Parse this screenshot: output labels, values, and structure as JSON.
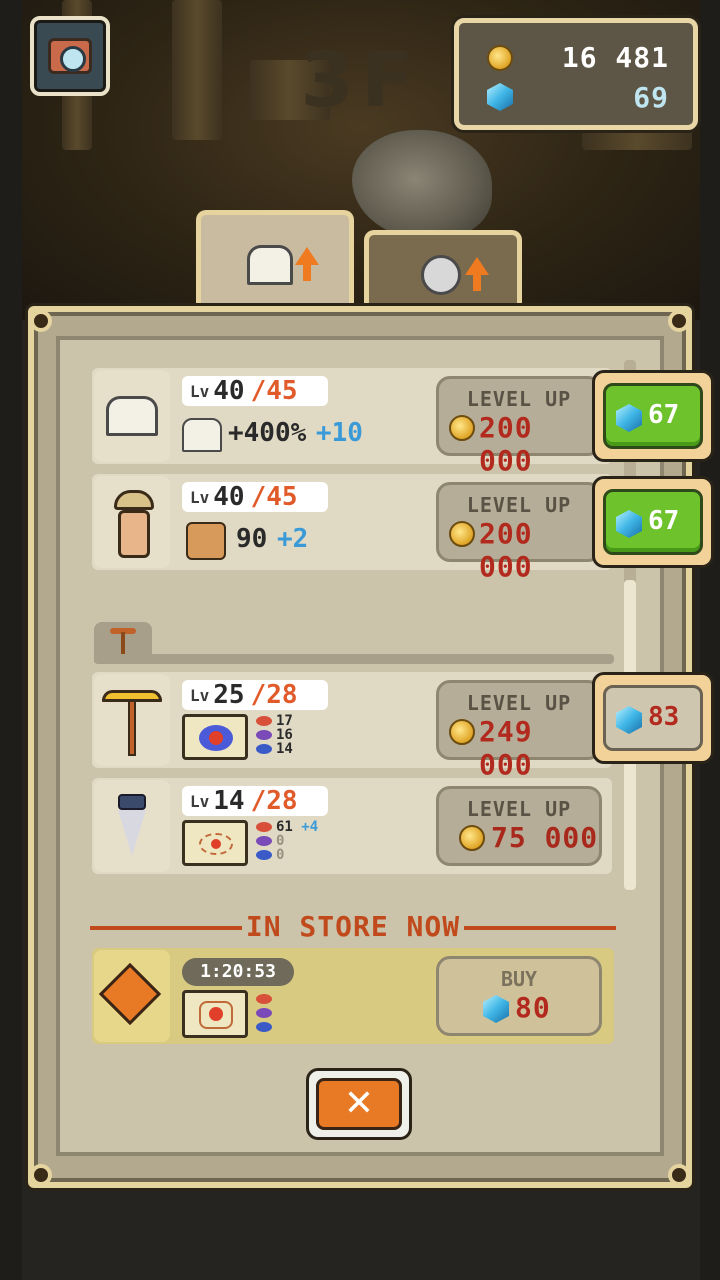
{
  "scene": {
    "floor_label": "3F"
  },
  "currency": {
    "gold": "16 481",
    "gems": "69"
  },
  "tabs": [
    {
      "icon": "building-upgrade-icon",
      "active": true
    },
    {
      "icon": "robot-upgrade-icon",
      "active": false
    }
  ],
  "upgrades": [
    {
      "icon": "museum-building-icon",
      "level": "40",
      "max": "/45",
      "stat": "+400%",
      "plus": "+10",
      "levelup_label": "LEVEL UP",
      "price": "200 000",
      "gem_cost": "67",
      "gem_button_style": "green"
    },
    {
      "icon": "explorer-worker-icon",
      "level": "40",
      "max": "/45",
      "stat": "90",
      "plus": "+2",
      "levelup_label": "LEVEL UP",
      "price": "200 000",
      "gem_cost": "67",
      "gem_button_style": "green"
    }
  ],
  "tools": [
    {
      "icon": "golden-pickaxe-icon",
      "level": "25",
      "max": "/28",
      "ores": [
        "17",
        "16",
        "14"
      ],
      "ore_plus": "",
      "levelup_label": "LEVEL UP",
      "price": "249 000",
      "gem_cost": "83",
      "gem_button_style": "grey"
    },
    {
      "icon": "drill-icon",
      "level": "14",
      "max": "/28",
      "ores": [
        "61",
        "0",
        "0"
      ],
      "ore_plus": "+4",
      "levelup_label": "LEVEL UP",
      "price": "75 000"
    }
  ],
  "lv_prefix": "Lv",
  "store": {
    "title": "IN STORE NOW",
    "timer": "1:20:53",
    "buy_label": "BUY",
    "gem_price": "80"
  },
  "close_label": "✕",
  "colors": {
    "accent_orange": "#e87a26",
    "price_red": "#b22a1e",
    "plus_blue": "#3a9ad8",
    "gem_green": "#6ec22c"
  }
}
